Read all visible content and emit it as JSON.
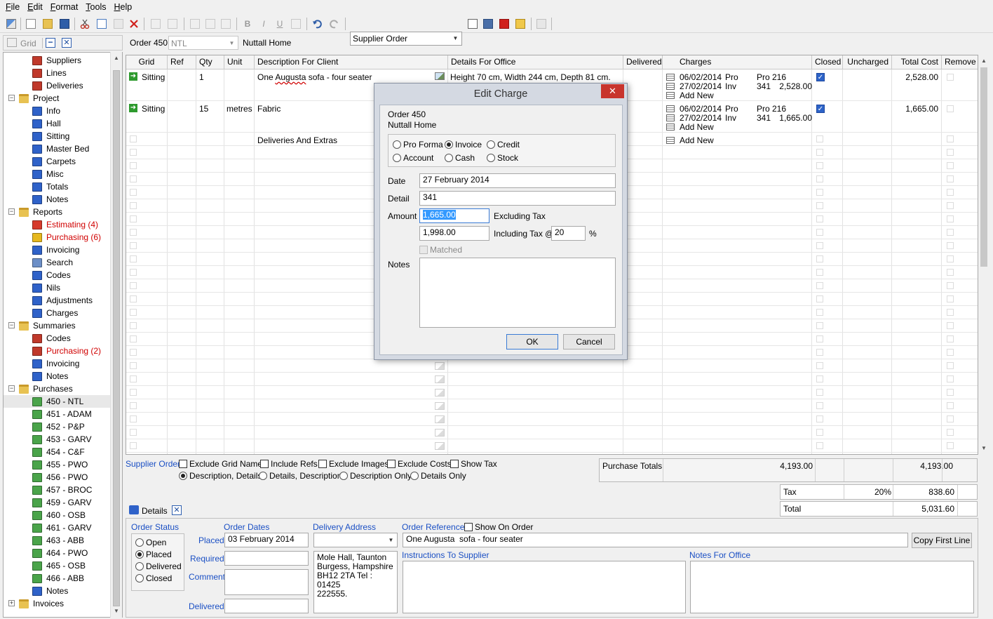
{
  "menu": [
    "File",
    "Edit",
    "Format",
    "Tools",
    "Help"
  ],
  "toolbar": {
    "report_select": "Supplier Order"
  },
  "sidebar": {
    "grid_label": "Grid",
    "items": [
      {
        "label": "Suppliers",
        "indent": 2,
        "icon": "book-icon",
        "color": "#c0392b",
        "red": false
      },
      {
        "label": "Lines",
        "indent": 2,
        "icon": "book-icon",
        "color": "#c0392b",
        "red": false
      },
      {
        "label": "Deliveries",
        "indent": 2,
        "icon": "book-icon",
        "color": "#c0392b",
        "red": false
      },
      {
        "label": "Project",
        "indent": 1,
        "icon": "folder-icon",
        "color": "#e8c252",
        "red": false,
        "expander": "-"
      },
      {
        "label": "Info",
        "indent": 2,
        "icon": "info-icon",
        "color": "#2f62c9",
        "red": false
      },
      {
        "label": "Hall",
        "indent": 2,
        "icon": "grid-icon",
        "color": "#2f62c9",
        "red": false
      },
      {
        "label": "Sitting",
        "indent": 2,
        "icon": "grid-icon",
        "color": "#2f62c9",
        "red": false
      },
      {
        "label": "Master Bed",
        "indent": 2,
        "icon": "grid-icon",
        "color": "#2f62c9",
        "red": false
      },
      {
        "label": "Carpets",
        "indent": 2,
        "icon": "grid-icon",
        "color": "#2f62c9",
        "red": false
      },
      {
        "label": "Misc",
        "indent": 2,
        "icon": "grid-icon",
        "color": "#2f62c9",
        "red": false
      },
      {
        "label": "Totals",
        "indent": 2,
        "icon": "totals-icon",
        "color": "#2f62c9",
        "red": false
      },
      {
        "label": "Notes",
        "indent": 2,
        "icon": "notes-icon",
        "color": "#2f62c9",
        "red": false
      },
      {
        "label": "Reports",
        "indent": 1,
        "icon": "folder-icon",
        "color": "#e8c252",
        "red": false,
        "expander": "-"
      },
      {
        "label": "Estimating (4)",
        "indent": 2,
        "icon": "estimating-icon",
        "color": "#d63a2c",
        "red": true
      },
      {
        "label": "Purchasing (6)",
        "indent": 2,
        "icon": "purchasing-icon",
        "color": "#e6b81e",
        "red": true
      },
      {
        "label": "Invoicing",
        "indent": 2,
        "icon": "invoicing-icon",
        "color": "#2f62c9",
        "red": false
      },
      {
        "label": "Search",
        "indent": 2,
        "icon": "search-icon",
        "color": "#6c8fc7",
        "red": false
      },
      {
        "label": "Codes",
        "indent": 2,
        "icon": "codes-icon",
        "color": "#2f62c9",
        "red": false
      },
      {
        "label": "Nils",
        "indent": 2,
        "icon": "nils-icon",
        "color": "#2f62c9",
        "red": false
      },
      {
        "label": "Adjustments",
        "indent": 2,
        "icon": "adjustments-icon",
        "color": "#2f62c9",
        "red": false
      },
      {
        "label": "Charges",
        "indent": 2,
        "icon": "charges-icon",
        "color": "#2f62c9",
        "red": false
      },
      {
        "label": "Summaries",
        "indent": 1,
        "icon": "folder-icon",
        "color": "#e8c252",
        "red": false,
        "expander": "-"
      },
      {
        "label": "Codes",
        "indent": 2,
        "icon": "book-icon",
        "color": "#c0392b",
        "red": false
      },
      {
        "label": "Purchasing (2)",
        "indent": 2,
        "icon": "book-icon",
        "color": "#c0392b",
        "red": true
      },
      {
        "label": "Invoicing",
        "indent": 2,
        "icon": "invoicing-icon",
        "color": "#2f62c9",
        "red": false
      },
      {
        "label": "Notes",
        "indent": 2,
        "icon": "info-icon",
        "color": "#2f62c9",
        "red": false
      },
      {
        "label": "Purchases",
        "indent": 1,
        "icon": "folder-icon",
        "color": "#e8c252",
        "red": false,
        "expander": "-"
      },
      {
        "label": "450 - NTL",
        "indent": 2,
        "icon": "order-icon",
        "color": "#4aa44a",
        "red": false,
        "selected": true
      },
      {
        "label": "451 - ADAM",
        "indent": 2,
        "icon": "order-icon",
        "color": "#4aa44a",
        "red": false
      },
      {
        "label": "452 - P&P",
        "indent": 2,
        "icon": "order-icon",
        "color": "#4aa44a",
        "red": false
      },
      {
        "label": "453 - GARV",
        "indent": 2,
        "icon": "order-icon",
        "color": "#4aa44a",
        "red": false
      },
      {
        "label": "454 - C&F",
        "indent": 2,
        "icon": "order-icon",
        "color": "#4aa44a",
        "red": false
      },
      {
        "label": "455 - PWO",
        "indent": 2,
        "icon": "order-icon",
        "color": "#4aa44a",
        "red": false
      },
      {
        "label": "456 - PWO",
        "indent": 2,
        "icon": "order-icon",
        "color": "#4aa44a",
        "red": false
      },
      {
        "label": "457 - BROC",
        "indent": 2,
        "icon": "order-icon",
        "color": "#4aa44a",
        "red": false
      },
      {
        "label": "459 - GARV",
        "indent": 2,
        "icon": "order-icon",
        "color": "#4aa44a",
        "red": false
      },
      {
        "label": "460 - OSB",
        "indent": 2,
        "icon": "order-icon",
        "color": "#4aa44a",
        "red": false
      },
      {
        "label": "461 - GARV",
        "indent": 2,
        "icon": "order-icon",
        "color": "#4aa44a",
        "red": false
      },
      {
        "label": "463 - ABB",
        "indent": 2,
        "icon": "order-icon",
        "color": "#4aa44a",
        "red": false
      },
      {
        "label": "464 - PWO",
        "indent": 2,
        "icon": "order-icon",
        "color": "#4aa44a",
        "red": false
      },
      {
        "label": "465 - OSB",
        "indent": 2,
        "icon": "order-icon",
        "color": "#4aa44a",
        "red": false
      },
      {
        "label": "466 - ABB",
        "indent": 2,
        "icon": "order-icon",
        "color": "#4aa44a",
        "red": false
      },
      {
        "label": "Notes",
        "indent": 2,
        "icon": "info-icon",
        "color": "#2f62c9",
        "red": false
      },
      {
        "label": "Invoices",
        "indent": 1,
        "icon": "folder-icon",
        "color": "#e8c252",
        "red": false,
        "expander": "+"
      }
    ]
  },
  "order_bar": {
    "order": "Order 450",
    "supplier_code": "NTL",
    "supplier_name": "Nuttall Home"
  },
  "grid": {
    "columns": [
      "Grid",
      "Ref",
      "Qty",
      "Unit",
      "Description For Client",
      "Details For Office",
      "Delivered",
      "Charges",
      "Closed",
      "Uncharged",
      "Total Cost",
      "Remove"
    ],
    "rows": [
      {
        "grid": "Sitting",
        "ref": "",
        "qty": "1",
        "unit": "",
        "desc_pre": "One ",
        "desc_mark": "Augusta",
        "desc_post": "  sofa - four seater",
        "details": "Height 70 cm, Width 244 cm, Depth 81 cm.",
        "charges": [
          {
            "date": "06/02/2014",
            "type": "Pro",
            "ref": "Pro 216",
            "amount": ""
          },
          {
            "date": "27/02/2014",
            "type": "Inv",
            "ref": "341",
            "amount": "2,528.00"
          }
        ],
        "add_new": "Add New",
        "total": "2,528.00"
      },
      {
        "grid": "Sitting",
        "ref": "",
        "qty": "15",
        "unit": "metres",
        "desc_pre": "Fabric",
        "desc_mark": "",
        "desc_post": "",
        "details": "",
        "charges": [
          {
            "date": "06/02/2014",
            "type": "Pro",
            "ref": "Pro 216",
            "amount": ""
          },
          {
            "date": "27/02/2014",
            "type": "Inv",
            "ref": "341",
            "amount": "1,665.00"
          }
        ],
        "add_new": "Add New",
        "total": "1,665.00"
      }
    ],
    "extras_row": {
      "desc": "Deliveries And Extras",
      "add_new": "Add New"
    }
  },
  "options": {
    "supplier_order": "Supplier Order",
    "checkboxes": [
      "Exclude Grid Names",
      "Include Refs",
      "Exclude Images",
      "Exclude Costs",
      "Show Tax"
    ],
    "radios": [
      "Description, Details",
      "Details, Description",
      "Description Only",
      "Details Only"
    ]
  },
  "totals": {
    "purchase_label": "Purchase Totals",
    "purchase_uncharged": "4,193.00",
    "purchase_total": "4,193.00",
    "tax_label": "Tax",
    "tax_rate": "20%",
    "tax_amount": "838.60",
    "total_label": "Total",
    "total_amount": "5,031.60"
  },
  "details": {
    "tab": "Details",
    "order_status_label": "Order Status",
    "statuses": [
      "Open",
      "Placed",
      "Delivered",
      "Closed"
    ],
    "order_dates_label": "Order Dates",
    "placed_label": "Placed",
    "placed_value": "03 February 2014",
    "required_label": "Required",
    "comment_label": "Comment",
    "delivered_label": "Delivered",
    "delivery_address_label": "Delivery Address",
    "delivery_address": "Mole Hall, Taunton\nBurgess, Hampshire\nBH12 2TA Tel : 01425\n222555.",
    "order_reference_label": "Order Reference",
    "show_on_order": "Show On Order",
    "order_reference_value": "One Augusta  sofa - four seater",
    "copy_first_line": "Copy First Line",
    "instructions_label": "Instructions To Supplier",
    "notes_office_label": "Notes For Office"
  },
  "dialog": {
    "title": "Edit Charge",
    "order": "Order 450",
    "supplier": "Nuttall Home",
    "types": [
      "Pro Forma",
      "Invoice",
      "Credit",
      "Account",
      "Cash",
      "Stock"
    ],
    "date_label": "Date",
    "date_value": "27 February 2014",
    "detail_label": "Detail",
    "detail_value": "341",
    "amount_label": "Amount",
    "amount_value": "1,665.00",
    "excluding_tax": "Excluding Tax",
    "incl_value": "1,998.00",
    "including_tax": "Including Tax @",
    "tax_rate": "20",
    "percent": "%",
    "matched": "Matched",
    "notes_label": "Notes",
    "ok": "OK",
    "cancel": "Cancel"
  }
}
